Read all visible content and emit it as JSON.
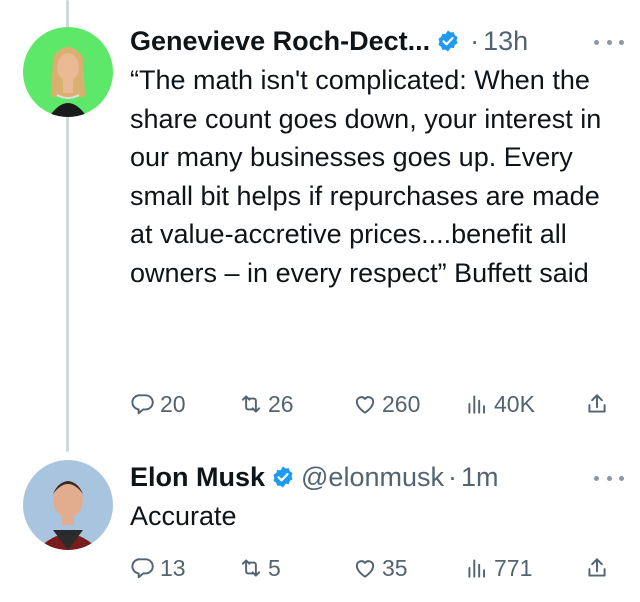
{
  "tweets": [
    {
      "author_name": "Genevieve Roch-Dect...",
      "handle": "",
      "separator": "·",
      "time": "13h",
      "text": "“The math isn't complicated: When the share count goes down, your interest in our many businesses goes up. Every small bit helps if repurchases are made at value-accretive prices....benefit all owners – in every respect” Buffett said",
      "replies": "20",
      "retweets": "26",
      "likes": "260",
      "views": "40K",
      "avatar_bg": "#5ee86a"
    },
    {
      "author_name": "Elon Musk",
      "handle": "@elonmusk",
      "separator": "·",
      "time": "1m",
      "text": "Accurate",
      "replies": "13",
      "retweets": "5",
      "likes": "35",
      "views": "771",
      "avatar_bg": "#a9c4de"
    }
  ],
  "colors": {
    "verified": "#1d9bf0",
    "secondary_text": "#536471",
    "thread_line": "#cfd9de"
  }
}
